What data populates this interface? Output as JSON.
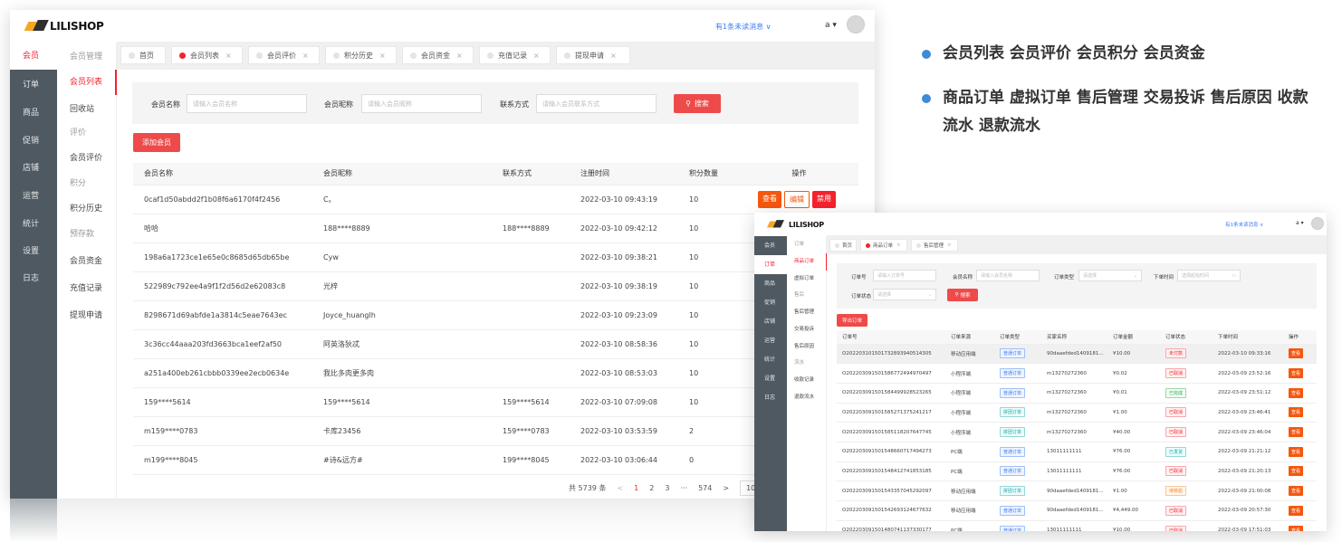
{
  "logo": {
    "text": "LILISHOP"
  },
  "bullets": [
    "会员列表 会员评价 会员积分 会员资金",
    "商品订单 虚拟订单 售后管理 交易投诉 售后原因 收款流水 退款流水"
  ],
  "window1": {
    "rail": [
      "会员",
      "订单",
      "商品",
      "促销",
      "店铺",
      "运营",
      "统计",
      "设置",
      "日志"
    ],
    "sub": [
      "会员管理",
      "会员列表",
      "回收站",
      "评价",
      "会员评价",
      "积分",
      "积分历史",
      "预存款",
      "会员资金",
      "充值记录",
      "提现申请"
    ],
    "header": {
      "messages": "有1条未读消息 ∨",
      "user": "a ▾"
    },
    "tabs": [
      "首页",
      "会员列表",
      "会员评价",
      "积分历史",
      "会员资金",
      "充值记录",
      "提现申请"
    ],
    "search": {
      "name_label": "会员名称",
      "name_placeholder": "请输入会员名称",
      "nick_label": "会员昵称",
      "nick_placeholder": "请输入会员昵称",
      "phone_label": "联系方式",
      "phone_placeholder": "请输入会员联系方式",
      "button": "搜索"
    },
    "add_button": "添加会员",
    "columns": [
      "会员名称",
      "会员昵称",
      "联系方式",
      "注册时间",
      "积分数量",
      "操作"
    ],
    "ops": {
      "view": "查看",
      "edit": "编辑",
      "ban": "禁用"
    },
    "rows": [
      [
        "0caf1d50abdd2f1b08f6a6170f4f2456",
        "C。",
        "",
        "2022-03-10 09:43:19",
        "10"
      ],
      [
        "哈哈",
        "188****8889",
        "188****8889",
        "2022-03-10 09:42:12",
        "10"
      ],
      [
        "198a6a1723ce1e65e0c8685d65db65be",
        "Cyw",
        "",
        "2022-03-10 09:38:21",
        "10"
      ],
      [
        "522989c792ee4a9f1f2d56d2e62083c8",
        "光梓",
        "",
        "2022-03-10 09:38:19",
        "10"
      ],
      [
        "8298671d69abfde1a3814c5eae7643ec",
        "Joyce_huanglh",
        "",
        "2022-03-10 09:23:09",
        "10"
      ],
      [
        "3c36cc44aaa203fd3663bca1eef2af50",
        "阿英洛狄忒",
        "",
        "2022-03-10 08:58:36",
        "10"
      ],
      [
        "a251a400eb261cbbb0339ee2ecb0634e",
        "我比多肉更多肉",
        "",
        "2022-03-10 08:53:03",
        "10"
      ],
      [
        "159****5614",
        "159****5614",
        "159****5614",
        "2022-03-10 07:09:08",
        "10"
      ],
      [
        "m159****0783",
        "卡库23456",
        "159****0783",
        "2022-03-10 03:53:59",
        "2"
      ],
      [
        "m199****8045",
        "#诗&远方#",
        "199****8045",
        "2022-03-10 03:06:44",
        "0"
      ]
    ],
    "pagination": {
      "total": "共 5739 条",
      "prev": "<",
      "pages": [
        "1",
        "2",
        "3",
        "···",
        "574"
      ],
      "next": ">",
      "size": "10"
    }
  },
  "window2": {
    "rail": [
      "会员",
      "订单",
      "商品",
      "促销",
      "店铺",
      "运营",
      "统计",
      "设置",
      "日志"
    ],
    "sub": [
      "订单",
      "商品订单",
      "虚拟订单",
      "售后",
      "售后管理",
      "交易投诉",
      "售后原因",
      "流水",
      "收款记录",
      "退款流水"
    ],
    "header": {
      "messages": "有1条未读消息 ∨",
      "user": "a ▾"
    },
    "tabs": [
      "首页",
      "商品订单",
      "售后管理"
    ],
    "search": {
      "order_no": "订单号",
      "order_no_ph": "请输入订单号",
      "member": "会员名称",
      "member_ph": "请输入会员名称",
      "type": "订单类型",
      "type_ph": "请选择",
      "time": "下单时间",
      "time_ph": "选择起始时间",
      "status": "订单状态",
      "status_ph": "请选择",
      "button": "搜索"
    },
    "export_button": "导出订单",
    "columns": [
      "订单号",
      "订单来源",
      "订单类型",
      "买家名称",
      "订单金额",
      "订单状态",
      "下单时间",
      "操作"
    ],
    "op": "查看",
    "rows": [
      [
        "O202203101501732893940514305",
        "移动应用端",
        "普通订单",
        "90daaefded1409181...",
        "¥10.00",
        "未付款",
        "2022-03-10 09:33:16"
      ],
      [
        "O202203091501586772494970497",
        "小程序端",
        "普通订单",
        "m13270272360",
        "¥0.02",
        "已取消",
        "2022-03-09 23:52:16"
      ],
      [
        "O202203091501584499928523265",
        "小程序端",
        "普通订单",
        "m13270272360",
        "¥0.01",
        "已完成",
        "2022-03-09 23:51:12"
      ],
      [
        "O202203091501585271375241217",
        "小程序端",
        "拼团订单",
        "m13270272360",
        "¥1.00",
        "已取消",
        "2022-03-09 23:46:41"
      ],
      [
        "O202203091501585118207647745",
        "小程序端",
        "拼团订单",
        "m13270272360",
        "¥40.00",
        "已取消",
        "2022-03-09 23:46:04"
      ],
      [
        "O202203091501548660717494273",
        "PC端",
        "普通订单",
        "13011111111",
        "¥76.00",
        "已发货",
        "2022-03-09 21:21:12"
      ],
      [
        "O202203091501548412741853185",
        "PC端",
        "普通订单",
        "13011111111",
        "¥76.00",
        "已取消",
        "2022-03-09 21:20:13"
      ],
      [
        "O202203091501543357045292097",
        "移动应用端",
        "拼团订单",
        "90daaefded1409181...",
        "¥1.00",
        "待核验",
        "2022-03-09 21:00:08"
      ],
      [
        "O202203091501542693124677632",
        "移动应用端",
        "普通订单",
        "90daaefded1409181...",
        "¥4,449.00",
        "已取消",
        "2022-03-09 20:57:30"
      ],
      [
        "O202203091501480741137330177",
        "PC端",
        "普通订单",
        "13011111111",
        "¥10.00",
        "已取消",
        "2022-03-09 17:51:03"
      ]
    ]
  }
}
